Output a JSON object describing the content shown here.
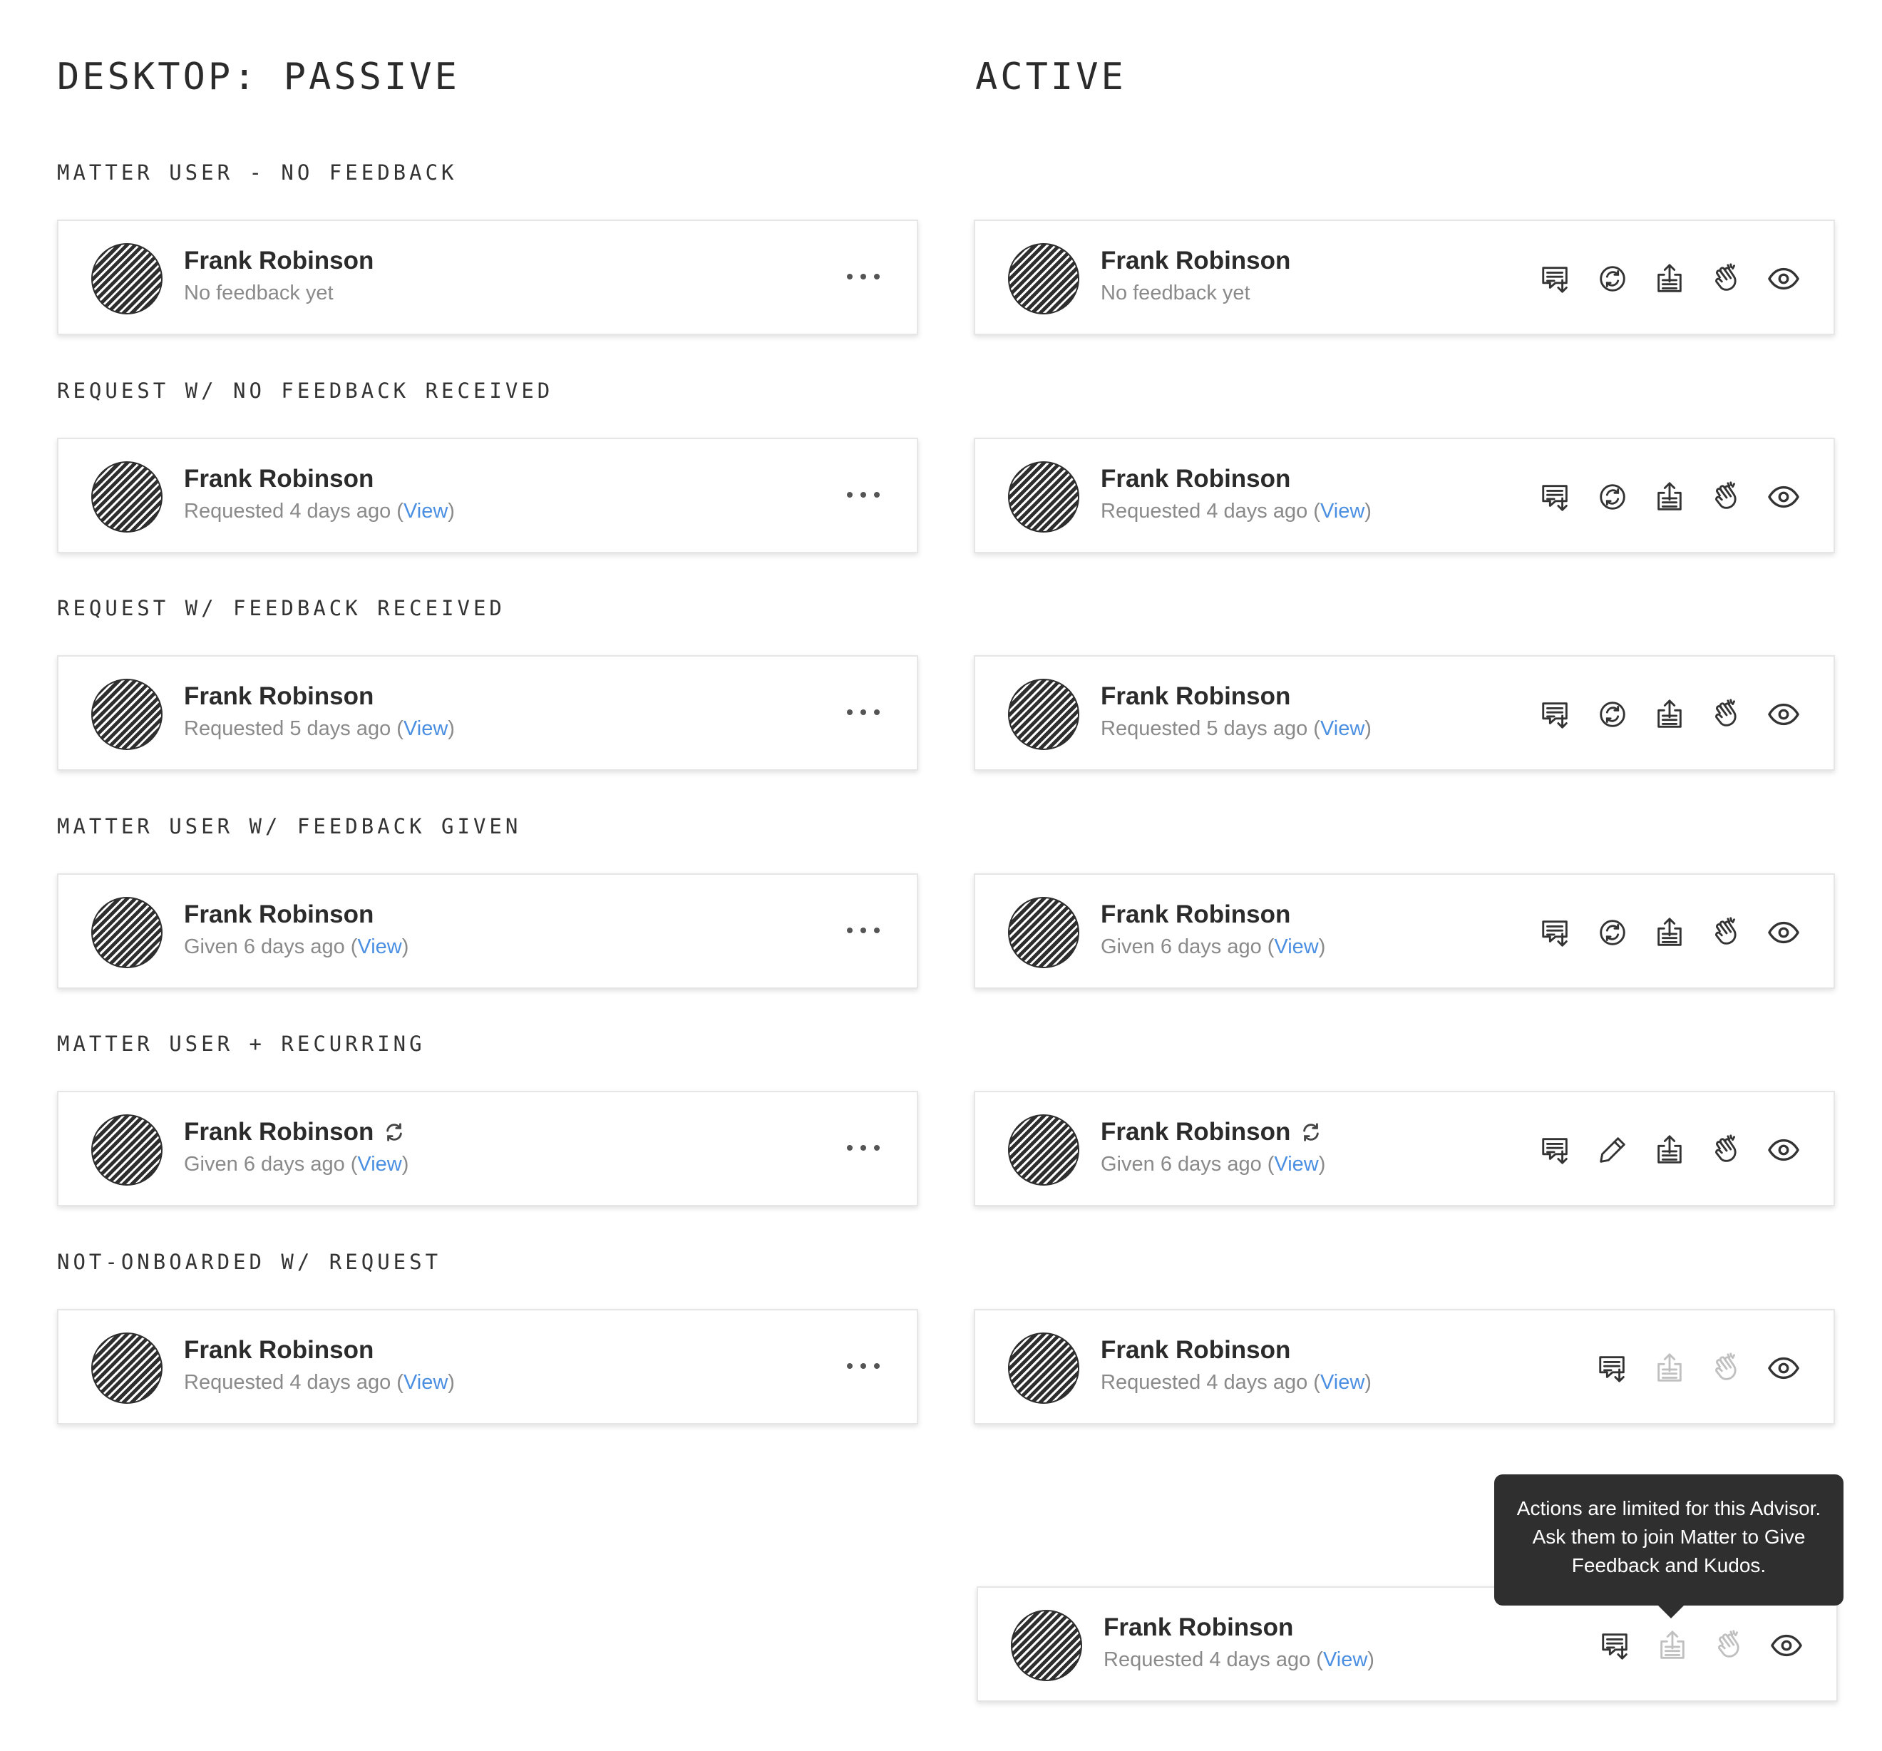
{
  "headers": {
    "passive": "DESKTOP: PASSIVE",
    "active": "ACTIVE"
  },
  "sections": [
    {
      "label": "MATTER USER - NO FEEDBACK",
      "name": "Frank Robinson",
      "status": "No feedback yet",
      "link": "",
      "recurring": false,
      "actions": [
        "request-feedback",
        "give-feedback",
        "share",
        "kudos",
        "view"
      ],
      "disabled": []
    },
    {
      "label": "REQUEST W/ NO FEEDBACK RECEIVED",
      "name": "Frank Robinson",
      "status": "Requested 4 days ago (",
      "link": "View",
      "status_end": ")",
      "recurring": false,
      "actions": [
        "request-feedback",
        "give-feedback",
        "share",
        "kudos",
        "view"
      ],
      "disabled": []
    },
    {
      "label": "REQUEST W/ FEEDBACK RECEIVED",
      "name": "Frank Robinson",
      "status": "Requested 5 days ago (",
      "link": "View",
      "status_end": ")",
      "recurring": false,
      "actions": [
        "request-feedback",
        "give-feedback",
        "share",
        "kudos",
        "view"
      ],
      "disabled": []
    },
    {
      "label": "MATTER USER W/ FEEDBACK GIVEN",
      "name": "Frank Robinson",
      "status": "Given 6 days ago (",
      "link": "View",
      "status_end": ")",
      "recurring": false,
      "actions": [
        "request-feedback",
        "give-feedback",
        "share",
        "kudos",
        "view"
      ],
      "disabled": []
    },
    {
      "label": "MATTER USER + RECURRING",
      "name": "Frank Robinson",
      "status": "Given 6 days ago (",
      "link": "View",
      "status_end": ")",
      "recurring": true,
      "actions": [
        "request-feedback",
        "edit",
        "share",
        "kudos",
        "view"
      ],
      "disabled": []
    },
    {
      "label": "NOT-ONBOARDED W/ REQUEST",
      "name": "Frank Robinson",
      "status": "Requested 4 days ago (",
      "link": "View",
      "status_end": ")",
      "recurring": false,
      "actions": [
        "request-feedback",
        "share",
        "kudos",
        "view"
      ],
      "disabled": [
        "share",
        "kudos"
      ]
    }
  ],
  "extra_card": {
    "name": "Frank Robinson",
    "status": "Requested 4 days ago (",
    "link": "View",
    "status_end": ")",
    "actions": [
      "request-feedback",
      "share",
      "kudos",
      "view"
    ],
    "disabled": [
      "share",
      "kudos"
    ]
  },
  "tooltip": {
    "text": "Actions are limited for this Advisor. Ask them to join Matter to Give Feedback and Kudos."
  },
  "icons": {
    "request-feedback": "request-feedback-icon",
    "give-feedback": "give-feedback-icon",
    "edit": "pencil-icon",
    "share": "share-icon",
    "kudos": "clap-icon",
    "view": "eye-icon"
  },
  "colors": {
    "link": "#4a8fe2",
    "tooltip_bg": "#2f2f2f",
    "text": "#2b2b2b",
    "muted": "#8a8a8a"
  }
}
